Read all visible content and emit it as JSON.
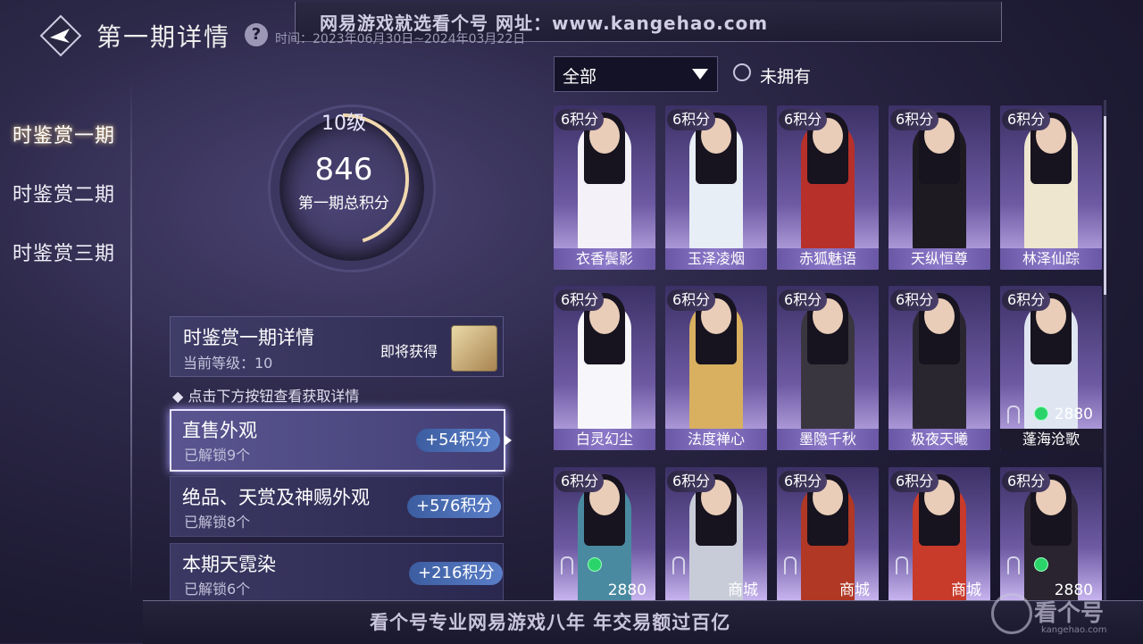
{
  "header": {
    "watermark_top": "网易游戏就选看个号   网址：www.kangehao.com",
    "title": "第一期详情",
    "help_icon": "?",
    "time_text": "时间：2023年06月30日~2024年03月22日"
  },
  "sidebar": {
    "items": [
      {
        "label": "时鉴赏一期"
      },
      {
        "label": "时鉴赏二期"
      },
      {
        "label": "时鉴赏三期"
      }
    ]
  },
  "progress": {
    "level": "10级",
    "score": "846",
    "score_label": "第一期总积分",
    "fill_fraction": 0.45
  },
  "info": {
    "title": "时鉴赏一期详情",
    "current_level": "当前等级：10",
    "upcoming": "即将获得",
    "hint": "◆ 点击下方按钮查看获取详情"
  },
  "categories": [
    {
      "title": "直售外观",
      "sub": "已解锁9个",
      "badge": "+54积分"
    },
    {
      "title": "绝品、天赏及神赐外观",
      "sub": "已解锁8个",
      "badge": "+576积分"
    },
    {
      "title": "本期天霓染",
      "sub": "已解锁6个",
      "badge": "+216积分"
    }
  ],
  "filter": {
    "selected": "全部",
    "toggle_label": "未拥有"
  },
  "grid": [
    {
      "pts": "6积分",
      "name": "衣香鬓影"
    },
    {
      "pts": "6积分",
      "name": "玉泽凌烟"
    },
    {
      "pts": "6积分",
      "name": "赤狐魅语"
    },
    {
      "pts": "6积分",
      "name": "天纵恒尊"
    },
    {
      "pts": "6积分",
      "name": "林泽仙踪"
    },
    {
      "pts": "6积分",
      "name": "白灵幻尘"
    },
    {
      "pts": "6积分",
      "name": "法度禅心"
    },
    {
      "pts": "6积分",
      "name": "墨隐千秋"
    },
    {
      "pts": "6积分",
      "name": "极夜天曦"
    },
    {
      "pts": "6积分",
      "name": "蓬海沧歌",
      "price": "2880"
    },
    {
      "pts": "6积分",
      "name": "",
      "price": "2880"
    },
    {
      "pts": "6积分",
      "name": "",
      "price": "商城"
    },
    {
      "pts": "6积分",
      "name": "",
      "price": "商城"
    },
    {
      "pts": "6积分",
      "name": "",
      "price": "商城"
    },
    {
      "pts": "6积分",
      "name": "",
      "price": "2880"
    }
  ],
  "footer": {
    "text": "看个号专业网易游戏八年   年交易额过百亿",
    "wm_text": "看个号",
    "wm_url": "kangehao.com"
  },
  "colors": {
    "accent": "#5a7fc8",
    "card_name_bg": "#8b78c8",
    "gem": "#2bd46b"
  }
}
